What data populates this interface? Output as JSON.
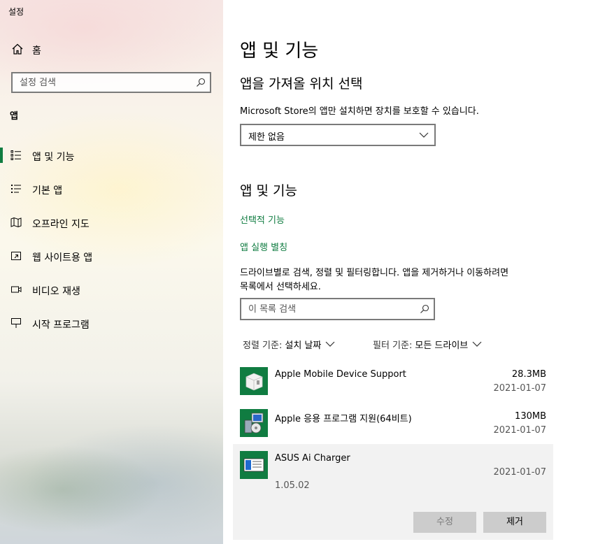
{
  "window": {
    "title": "설정"
  },
  "sidebar": {
    "home_label": "홈",
    "search_placeholder": "설정 검색",
    "section_label": "앱",
    "items": [
      {
        "label": "앱 및 기능",
        "icon": "apps-features-icon",
        "selected": true
      },
      {
        "label": "기본 앱",
        "icon": "default-apps-icon",
        "selected": false
      },
      {
        "label": "오프라인 지도",
        "icon": "offline-maps-icon",
        "selected": false
      },
      {
        "label": "웹 사이트용 앱",
        "icon": "apps-for-websites-icon",
        "selected": false
      },
      {
        "label": "비디오 재생",
        "icon": "video-playback-icon",
        "selected": false
      },
      {
        "label": "시작 프로그램",
        "icon": "startup-icon",
        "selected": false
      }
    ]
  },
  "main": {
    "title": "앱 및 기능",
    "install_source": {
      "heading": "앱을 가져올 위치 선택",
      "description": "Microsoft Store의 앱만 설치하면 장치를 보호할 수 있습니다.",
      "dropdown_value": "제한 없음"
    },
    "apps_section": {
      "heading": "앱 및 기능",
      "optional_features_link": "선택적 기능",
      "app_aliases_link": "앱 실행 별칭",
      "description_line1": "드라이브별로 검색, 정렬 및 필터링합니다. 앱을 제거하거나 이동하려면",
      "description_line2": "목록에서 선택하세요.",
      "search_placeholder": "이 목록 검색",
      "sort_label": "정렬 기준:",
      "sort_value": "설치 날짜",
      "filter_label": "필터 기준:",
      "filter_value": "모든 드라이브"
    },
    "apps": [
      {
        "name": "Apple Mobile Device Support",
        "size": "28.3MB",
        "date": "2021-01-07",
        "version": "",
        "selected": false
      },
      {
        "name": "Apple 응용 프로그램 지원(64비트)",
        "size": "130MB",
        "date": "2021-01-07",
        "version": "",
        "selected": false
      },
      {
        "name": "ASUS Ai Charger",
        "size": "",
        "date": "2021-01-07",
        "version": "1.05.02",
        "selected": true
      }
    ],
    "buttons": {
      "modify": "수정",
      "uninstall": "제거"
    }
  },
  "colors": {
    "accent": "#107c41",
    "selected_row": "#f2f2f2",
    "button": "#cccccc"
  }
}
